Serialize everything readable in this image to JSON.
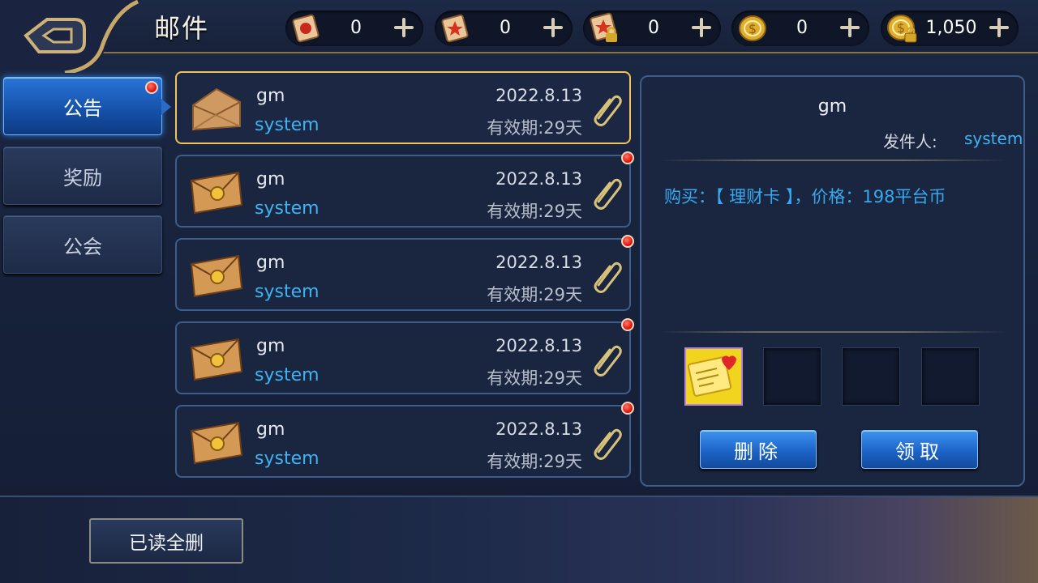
{
  "header": {
    "title": "邮件",
    "currencies": [
      {
        "icon": "red-scroll-icon",
        "value": "0"
      },
      {
        "icon": "star-scroll-icon",
        "value": "0"
      },
      {
        "icon": "locked-scroll-icon",
        "value": "0"
      },
      {
        "icon": "gold-coin-icon",
        "value": "0"
      },
      {
        "icon": "locked-gold-coin-icon",
        "value": "1,050"
      }
    ]
  },
  "tabs": [
    {
      "label": "公告",
      "active": true,
      "has_dot": true
    },
    {
      "label": "奖励",
      "active": false,
      "has_dot": false
    },
    {
      "label": "公会",
      "active": false,
      "has_dot": false
    }
  ],
  "mails": [
    {
      "title": "gm",
      "sender": "system",
      "date": "2022.8.13",
      "expire": "有效期:29天",
      "opened": true,
      "unread": false
    },
    {
      "title": "gm",
      "sender": "system",
      "date": "2022.8.13",
      "expire": "有效期:29天",
      "opened": false,
      "unread": true
    },
    {
      "title": "gm",
      "sender": "system",
      "date": "2022.8.13",
      "expire": "有效期:29天",
      "opened": false,
      "unread": true
    },
    {
      "title": "gm",
      "sender": "system",
      "date": "2022.8.13",
      "expire": "有效期:29天",
      "opened": false,
      "unread": true
    },
    {
      "title": "gm",
      "sender": "system",
      "date": "2022.8.13",
      "expire": "有效期:29天",
      "opened": false,
      "unread": true
    }
  ],
  "detail": {
    "title": "gm",
    "from_label": "发件人:",
    "from": "system",
    "content": "购买：【 理财卡 】，价格：198平台币",
    "attachments": [
      "financial-card-item-icon",
      "",
      "",
      ""
    ],
    "delete_label": "删除",
    "claim_label": "领取"
  },
  "footer": {
    "delete_all_label": "已读全删"
  },
  "colors": {
    "accent_blue": "#3fb3f2",
    "selected_border": "#f2c25a",
    "panel_border": "#3e5d8a"
  }
}
